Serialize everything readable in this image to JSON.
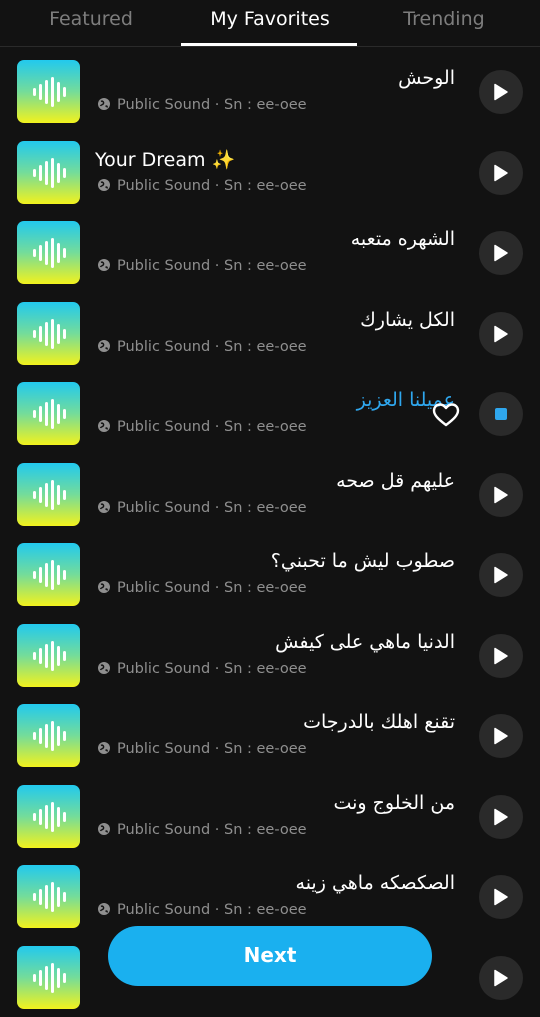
{
  "tabs": [
    {
      "label": "Featured"
    },
    {
      "label": "My Favorites"
    },
    {
      "label": "Trending"
    }
  ],
  "icons": {
    "thumbnail": "sound-wave-icon",
    "subtitle": "globe-icon",
    "play": "play-icon",
    "stop": "stop-icon",
    "favorite": "heart-outline-icon"
  },
  "colors": {
    "background": "#121212",
    "accent": "#2fa7ee",
    "next_button": "#1ab0ef"
  },
  "sounds": [
    {
      "title": "الوحش",
      "subtitle": "Public Sound · Sn : ee-oee",
      "playing": false
    },
    {
      "title": "Your Dream ✨",
      "subtitle": "Public Sound · Sn : ee-oee",
      "playing": false
    },
    {
      "title": "الشهره متعبه",
      "subtitle": "Public Sound · Sn : ee-oee",
      "playing": false
    },
    {
      "title": "الكل يشارك",
      "subtitle": "Public Sound · Sn : ee-oee",
      "playing": false
    },
    {
      "title": "عميلنا العزيز",
      "subtitle": "Public Sound · Sn : ee-oee",
      "playing": true
    },
    {
      "title": "عليهم قل صحه",
      "subtitle": "Public Sound · Sn : ee-oee",
      "playing": false
    },
    {
      "title": "صطوب ليش ما تحبني؟",
      "subtitle": "Public Sound · Sn : ee-oee",
      "playing": false
    },
    {
      "title": "الدنيا ماهي على كيفش",
      "subtitle": "Public Sound · Sn : ee-oee",
      "playing": false
    },
    {
      "title": "تقنع اهلك بالدرجات",
      "subtitle": "Public Sound · Sn : ee-oee",
      "playing": false
    },
    {
      "title": "من الخلوج ونت",
      "subtitle": "Public Sound · Sn : ee-oee",
      "playing": false
    },
    {
      "title": "الصكصكه ماهي زينه",
      "subtitle": "Public Sound · Sn : ee-oee",
      "playing": false
    },
    {
      "title": "",
      "subtitle": "",
      "playing": false
    }
  ],
  "next_button": {
    "label": "Next"
  }
}
